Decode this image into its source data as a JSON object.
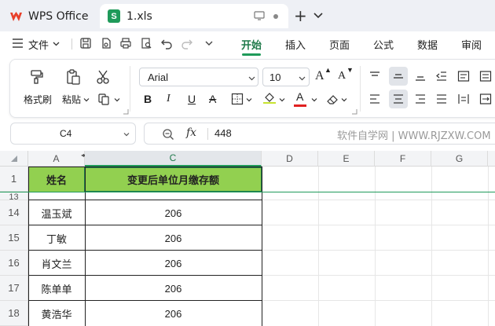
{
  "tabs": {
    "app_label": "WPS Office",
    "doc_label": "1.xls",
    "doc_icon_letter": "S",
    "new_tab": "+"
  },
  "menu": {
    "file_label": "文件",
    "tabs": [
      "开始",
      "插入",
      "页面",
      "公式",
      "数据",
      "审阅"
    ],
    "active_tab": "开始"
  },
  "ribbon": {
    "format_painter_label": "格式刷",
    "paste_label": "粘贴",
    "font_name": "Arial",
    "font_size": "10",
    "bold": "B",
    "italic": "I",
    "underline": "U",
    "strikethrough": "A",
    "font_color_letter": "A",
    "font_color": "#e02020",
    "fill_color": "#c7e330",
    "grow_font": "A",
    "shrink_font": "A"
  },
  "formula_bar": {
    "cell_ref": "C4",
    "fx": "fx",
    "value": "448",
    "watermark": "软件自学网 | WWW.RJZXW.COM"
  },
  "sheet": {
    "columns": [
      "A",
      "C",
      "D",
      "E",
      "F",
      "G"
    ],
    "selected_column": "C",
    "rows": [
      {
        "num": "1",
        "name": "姓名",
        "value": "变更后单位月缴存额",
        "is_header": true
      },
      {
        "num": "13",
        "name": "",
        "value": ""
      },
      {
        "num": "14",
        "name": "温玉斌",
        "value": "206"
      },
      {
        "num": "15",
        "name": "丁敏",
        "value": "206"
      },
      {
        "num": "16",
        "name": "肖文兰",
        "value": "206"
      },
      {
        "num": "17",
        "name": "陈单单",
        "value": "206"
      },
      {
        "num": "18",
        "name": "黄浩华",
        "value": "206"
      }
    ],
    "header_fill": "#92d050",
    "accent": "#1f9a5a"
  }
}
